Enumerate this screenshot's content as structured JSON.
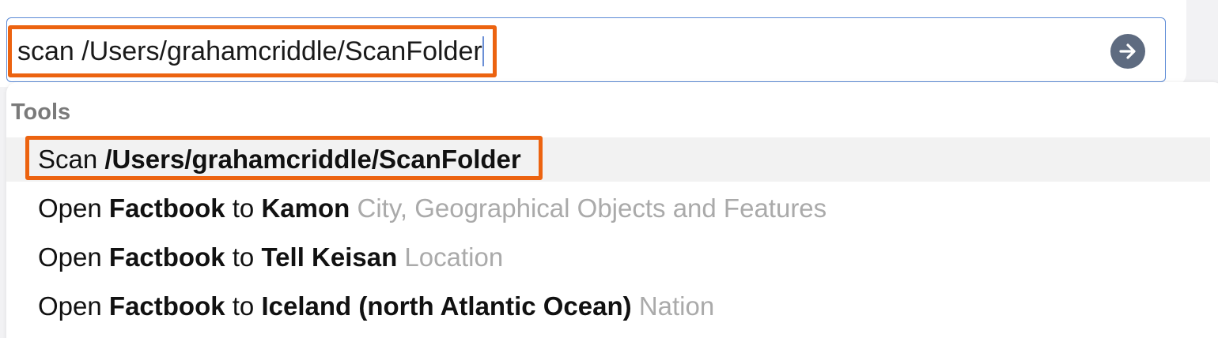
{
  "search": {
    "value": "scan /Users/grahamcriddle/ScanFolder",
    "go_icon": "arrow-right-circle-icon"
  },
  "dropdown": {
    "section_title": "Tools",
    "items": [
      {
        "verb": "Scan",
        "bold1": "/Users/grahamcriddle/ScanFolder",
        "connector": "",
        "bold2": "",
        "sub": ""
      },
      {
        "verb": "Open",
        "bold1": "Factbook",
        "connector": "to",
        "bold2": "Kamon",
        "sub": "City, Geographical Objects and Features"
      },
      {
        "verb": "Open",
        "bold1": "Factbook",
        "connector": "to",
        "bold2": "Tell Keisan",
        "sub": "Location"
      },
      {
        "verb": "Open",
        "bold1": "Factbook",
        "connector": "to",
        "bold2": "Iceland (north Atlantic Ocean)",
        "sub": "Nation"
      }
    ]
  },
  "colors": {
    "highlight": "#ec6310",
    "focus_border": "#5b8ad6",
    "go_button": "#5e6b80"
  }
}
